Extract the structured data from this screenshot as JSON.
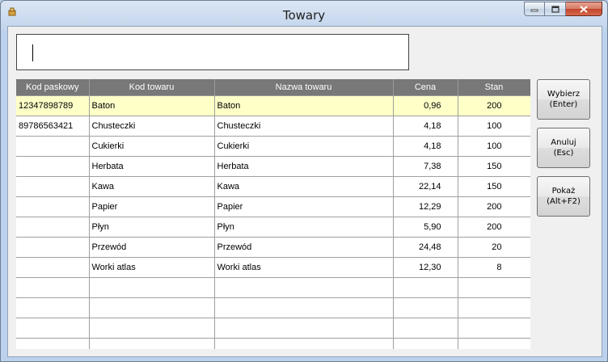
{
  "window": {
    "title": "Towary"
  },
  "search": {
    "value": ""
  },
  "table": {
    "columns": [
      "Kod paskowy",
      "Kod towaru",
      "Nazwa towaru",
      "Cena",
      "Stan"
    ],
    "rows": [
      [
        "12347898789",
        "Baton",
        "Baton",
        "0,96",
        "200"
      ],
      [
        "89786563421",
        "Chusteczki",
        "Chusteczki",
        "4,18",
        "100"
      ],
      [
        "",
        "Cukierki",
        "Cukierki",
        "4,18",
        "100"
      ],
      [
        "",
        "Herbata",
        "Herbata",
        "7,38",
        "150"
      ],
      [
        "",
        "Kawa",
        "Kawa",
        "22,14",
        "150"
      ],
      [
        "",
        "Papier",
        "Papier",
        "12,29",
        "200"
      ],
      [
        "",
        "Płyn",
        "Płyn",
        "5,90",
        "200"
      ],
      [
        "",
        "Przewód",
        "Przewód",
        "24,48",
        "20"
      ],
      [
        "",
        "Worki atlas",
        "Worki atlas",
        "12,30",
        "8"
      ]
    ],
    "empty_rows": 4,
    "selected_row": 0
  },
  "buttons": {
    "select": {
      "line1": "Wybierz",
      "line2": "(Enter)"
    },
    "cancel": {
      "line1": "Anuluj",
      "line2": "(Esc)"
    },
    "show": {
      "line1": "Pokaż",
      "line2": "(Alt+F2)"
    }
  },
  "icons": {
    "app": "app-icon",
    "minimize": "minimize-icon",
    "maximize": "maximize-icon",
    "close": "close-icon"
  },
  "colors": {
    "header_bg": "#787878",
    "selected_row_bg": "#ffffc8",
    "close_button": "#c2452a"
  }
}
